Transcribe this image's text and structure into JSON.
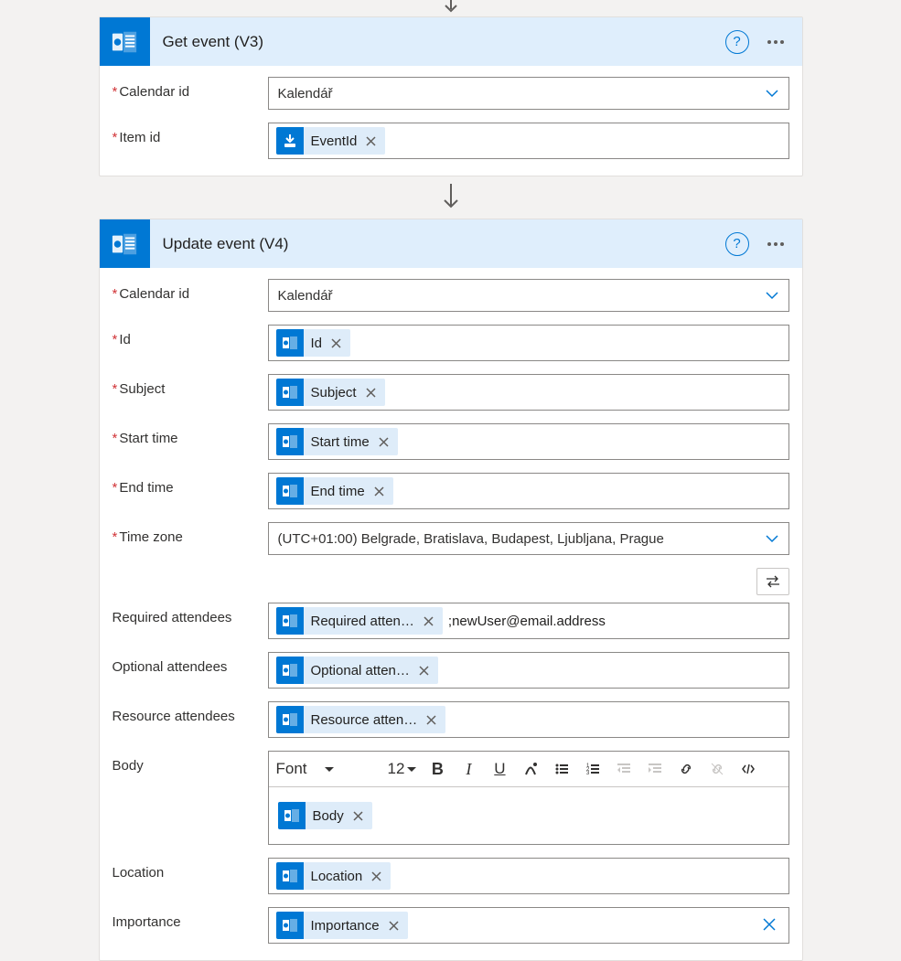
{
  "step1": {
    "title": "Get event (V3)",
    "fields": {
      "calendar_id": {
        "label": "Calendar id",
        "value": "Kalendář"
      },
      "item_id": {
        "label": "Item id",
        "token": "EventId"
      }
    }
  },
  "step2": {
    "title": "Update event (V4)",
    "fields": {
      "calendar_id": {
        "label": "Calendar id",
        "value": "Kalendář"
      },
      "id": {
        "label": "Id",
        "token": "Id"
      },
      "subject": {
        "label": "Subject",
        "token": "Subject"
      },
      "start_time": {
        "label": "Start time",
        "token": "Start time"
      },
      "end_time": {
        "label": "End time",
        "token": "End time"
      },
      "time_zone": {
        "label": "Time zone",
        "value": "(UTC+01:00) Belgrade, Bratislava, Budapest, Ljubljana, Prague"
      },
      "req_att": {
        "label": "Required attendees",
        "token": "Required atten…",
        "extra": ";newUser@email.address"
      },
      "opt_att": {
        "label": "Optional attendees",
        "token": "Optional atten…"
      },
      "res_att": {
        "label": "Resource attendees",
        "token": "Resource atten…"
      },
      "body": {
        "label": "Body",
        "token": "Body"
      },
      "location": {
        "label": "Location",
        "token": "Location"
      },
      "importance": {
        "label": "Importance",
        "token": "Importance"
      }
    },
    "rte": {
      "font": "Font",
      "size": "12"
    }
  }
}
